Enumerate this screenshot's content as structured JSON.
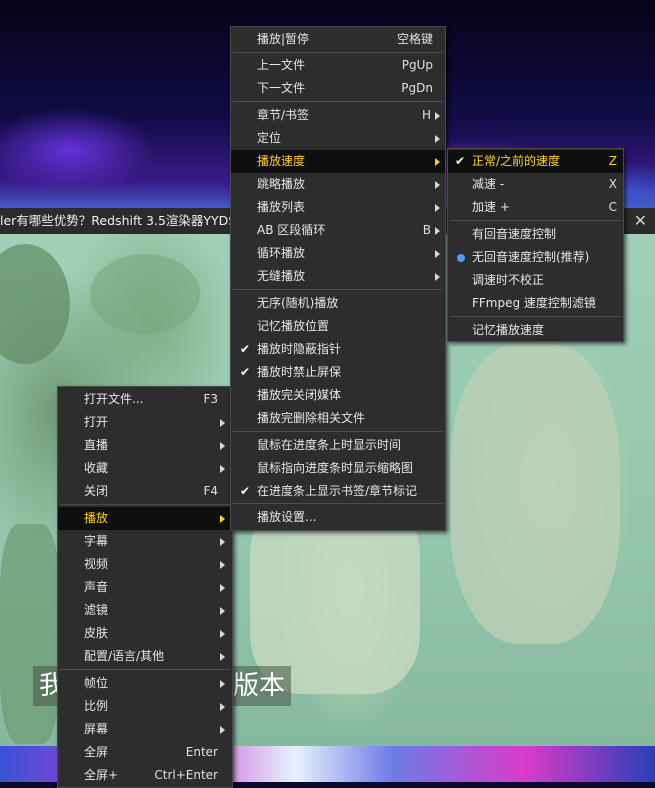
{
  "video_title": "ler有哪些优势？Redshift 3.5渲染器YYDS",
  "subtitle": {
    "left": "我",
    "right": "D版本"
  },
  "main_menu": [
    {
      "label": "打开文件...",
      "shortcut": "F3",
      "submenu": false
    },
    {
      "label": "打开",
      "shortcut": "",
      "submenu": true
    },
    {
      "label": "直播",
      "shortcut": "",
      "submenu": true
    },
    {
      "label": "收藏",
      "shortcut": "",
      "submenu": true
    },
    {
      "label": "关闭",
      "shortcut": "F4",
      "submenu": false
    },
    {
      "label": "播放",
      "shortcut": "",
      "submenu": true,
      "highlighted": true
    },
    {
      "label": "字幕",
      "shortcut": "",
      "submenu": true
    },
    {
      "label": "视频",
      "shortcut": "",
      "submenu": true
    },
    {
      "label": "声音",
      "shortcut": "",
      "submenu": true
    },
    {
      "label": "滤镜",
      "shortcut": "",
      "submenu": true
    },
    {
      "label": "皮肤",
      "shortcut": "",
      "submenu": true
    },
    {
      "label": "配置/语言/其他",
      "shortcut": "",
      "submenu": true
    },
    {
      "label": "帧位",
      "shortcut": "",
      "submenu": true
    },
    {
      "label": "比例",
      "shortcut": "",
      "submenu": true
    },
    {
      "label": "屏幕",
      "shortcut": "",
      "submenu": true
    },
    {
      "label": "全屏",
      "shortcut": "Enter",
      "submenu": false
    },
    {
      "label": "全屏+",
      "shortcut": "Ctrl+Enter",
      "submenu": false
    }
  ],
  "play_menu": [
    {
      "label": "播放|暂停",
      "shortcut": "空格键",
      "submenu": false
    },
    {
      "label": "上一文件",
      "shortcut": "PgUp",
      "submenu": false
    },
    {
      "label": "下一文件",
      "shortcut": "PgDn",
      "submenu": false
    },
    {
      "label": "章节/书签",
      "shortcut": "H",
      "submenu": true
    },
    {
      "label": "定位",
      "shortcut": "",
      "submenu": true
    },
    {
      "label": "播放速度",
      "shortcut": "",
      "submenu": true,
      "highlighted": true
    },
    {
      "label": "跳略播放",
      "shortcut": "",
      "submenu": true
    },
    {
      "label": "播放列表",
      "shortcut": "",
      "submenu": true
    },
    {
      "label": "AB 区段循环",
      "shortcut": "B",
      "submenu": true
    },
    {
      "label": "循环播放",
      "shortcut": "",
      "submenu": true
    },
    {
      "label": "无缝播放",
      "shortcut": "",
      "submenu": true
    },
    {
      "label": "无序(随机)播放",
      "shortcut": "",
      "submenu": false
    },
    {
      "label": "记忆播放位置",
      "shortcut": "",
      "submenu": false
    },
    {
      "label": "播放时隐蔽指针",
      "shortcut": "",
      "submenu": false,
      "checked": true
    },
    {
      "label": "播放时禁止屏保",
      "shortcut": "",
      "submenu": false,
      "checked": true
    },
    {
      "label": "播放完关闭媒体",
      "shortcut": "",
      "submenu": false
    },
    {
      "label": "播放完删除相关文件",
      "shortcut": "",
      "submenu": false
    },
    {
      "label": "鼠标在进度条上时显示时间",
      "shortcut": "",
      "submenu": false
    },
    {
      "label": "鼠标指向进度条时显示缩略图",
      "shortcut": "",
      "submenu": false
    },
    {
      "label": "在进度条上显示书签/章节标记",
      "shortcut": "",
      "submenu": false,
      "checked": true
    },
    {
      "label": "播放设置...",
      "shortcut": "",
      "submenu": false
    }
  ],
  "speed_menu": [
    {
      "label": "正常/之前的速度",
      "shortcut": "Z",
      "checked": true,
      "highlighted": true
    },
    {
      "label": "减速 -",
      "shortcut": "X"
    },
    {
      "label": "加速 +",
      "shortcut": "C"
    },
    {
      "label": "有回音速度控制",
      "shortcut": ""
    },
    {
      "label": "无回音速度控制(推荐)",
      "shortcut": "",
      "radio": true
    },
    {
      "label": "调速时不校正",
      "shortcut": ""
    },
    {
      "label": "FFmpeg 速度控制滤镜",
      "shortcut": ""
    },
    {
      "label": "记忆播放速度",
      "shortcut": ""
    }
  ],
  "icons": {
    "check": "check-icon",
    "radio": "radio-dot-icon",
    "submenu": "submenu-arrow-icon",
    "close": "close-icon"
  },
  "colors": {
    "highlight_text": "#ffd21f",
    "menu_bg": "#2d2d2d",
    "radio": "#4a9cff"
  }
}
